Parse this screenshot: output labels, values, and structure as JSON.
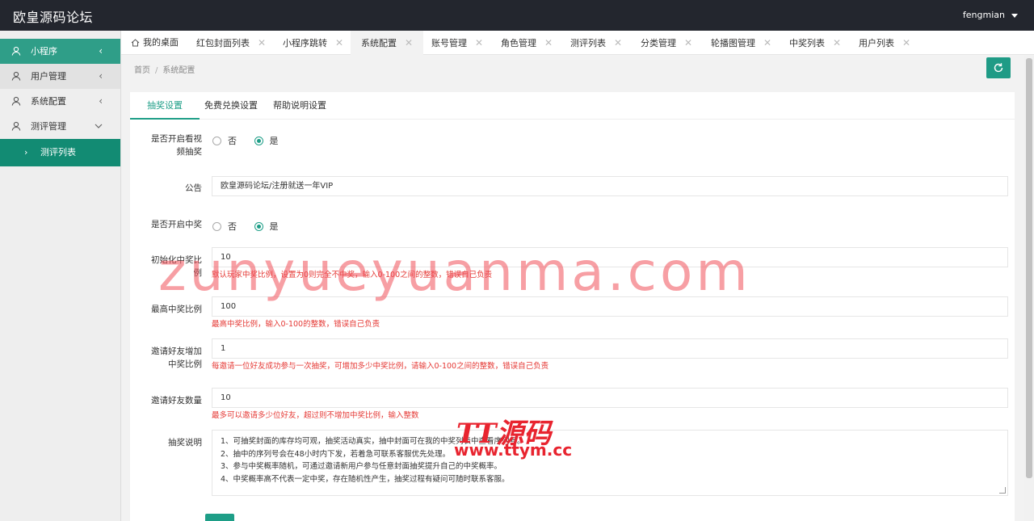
{
  "app": {
    "title": "欧皇源码论坛",
    "user": "fengmian"
  },
  "sidebar": {
    "items": [
      {
        "label": "小程序"
      },
      {
        "label": "用户管理"
      },
      {
        "label": "系统配置"
      },
      {
        "label": "测评管理"
      }
    ],
    "sub_item": {
      "label": "测评列表"
    }
  },
  "tabs": [
    {
      "label": "我的桌面"
    },
    {
      "label": "红包封面列表"
    },
    {
      "label": "小程序跳转"
    },
    {
      "label": "系统配置"
    },
    {
      "label": "账号管理"
    },
    {
      "label": "角色管理"
    },
    {
      "label": "测评列表"
    },
    {
      "label": "分类管理"
    },
    {
      "label": "轮播图管理"
    },
    {
      "label": "中奖列表"
    },
    {
      "label": "用户列表"
    }
  ],
  "breadcrumb": {
    "home": "首页",
    "sep": "/",
    "current": "系统配置"
  },
  "card_tabs": [
    {
      "label": "抽奖设置"
    },
    {
      "label": "免费兑换设置"
    },
    {
      "label": "帮助说明设置"
    }
  ],
  "form": {
    "video_lottery": {
      "label_line1": "是否开启看视",
      "label_line2": "频抽奖",
      "opt_no": "否",
      "opt_yes": "是",
      "selected": "是"
    },
    "notice": {
      "label": "公告",
      "value": "欧皇源码论坛/注册就送一年VIP"
    },
    "win_enabled": {
      "label": "是否开启中奖",
      "opt_no": "否",
      "opt_yes": "是",
      "selected": "是"
    },
    "init_ratio": {
      "label_line1": "初始化中奖比",
      "label_line2": "例",
      "value": "10",
      "hint": "默认玩家中奖比例，设置为0则完全不中奖，输入0-100之间的整数，错误自己负责"
    },
    "max_ratio": {
      "label": "最高中奖比例",
      "value": "100",
      "hint": "最高中奖比例，输入0-100的整数，错误自己负责"
    },
    "invite_ratio": {
      "label_line1": "邀请好友增加",
      "label_line2": "中奖比例",
      "value": "1",
      "hint": "每邀请一位好友成功参与一次抽奖，可增加多少中奖比例，请输入0-100之间的整数，错误自己负责"
    },
    "invite_count": {
      "label": "邀请好友数量",
      "value": "10",
      "hint": "最多可以邀请多少位好友，超过则不增加中奖比例，输入整数"
    },
    "description": {
      "label": "抽奖说明",
      "lines": [
        "1、可抽奖封面的库存均可观，抽奖活动真实，抽中封面可在我的中奖列表中查看序列号。",
        "2、抽中的序列号会在48小时内下发，若着急可联系客服优先处理。",
        "3、参与中奖概率随机，可通过邀请新用户参与任意封面抽奖提升自己的中奖概率。",
        "4、中奖概率高不代表一定中奖，存在随机性产生，抽奖过程有疑问可随时联系客服。"
      ]
    }
  },
  "watermarks": {
    "site": "zunyueyuanma.com",
    "brand": "TT源码",
    "brand_url": "www.ttym.cc"
  },
  "colors": {
    "accent": "#1e9e87",
    "sidebar_active": "#2f9e88",
    "sub_active": "#128b73",
    "header": "#23262e",
    "hint": "#e53935"
  }
}
